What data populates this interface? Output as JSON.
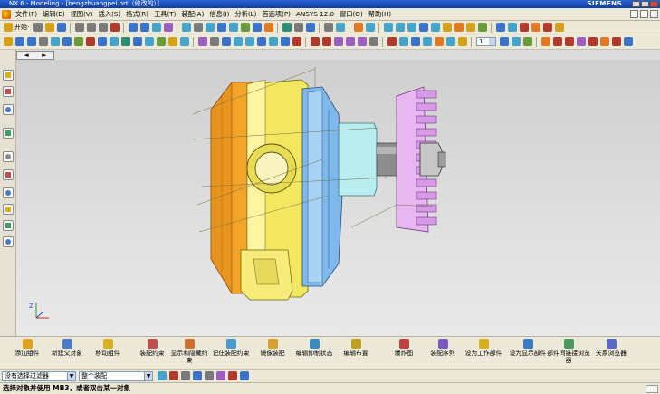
{
  "window": {
    "title": "NX 6 - Modeling - [bengzhuangpei.prt（修改的）]",
    "brand": "SIEMENS"
  },
  "menu": {
    "items": [
      "文件(F)",
      "编辑(E)",
      "视图(V)",
      "插入(S)",
      "格式(R)",
      "工具(T)",
      "装配(A)",
      "信息(I)",
      "分析(L)",
      "首选项(P)",
      "ANSYS 12.0",
      "窗口(O)",
      "帮助(H)"
    ]
  },
  "toolbar": {
    "start_label": "开始·",
    "layer_value": "1"
  },
  "nav": {
    "left_arrow": "◄",
    "right_arrow": "►"
  },
  "viewport": {
    "triad_label": "Z"
  },
  "assembly_toolbar": {
    "buttons": [
      {
        "label": "添加组件",
        "icon": "add-component-icon",
        "color": "#e0a020"
      },
      {
        "label": "新建父对象",
        "icon": "new-parent-icon",
        "color": "#4a7ac8"
      },
      {
        "label": "移动组件",
        "icon": "move-component-icon",
        "color": "#d8b020"
      },
      {
        "label": "装配约束",
        "icon": "assembly-constraint-icon",
        "color": "#c05050"
      },
      {
        "label": "显示和隐藏约束",
        "icon": "show-hide-constraint-icon",
        "color": "#d07030"
      },
      {
        "label": "记住装配约束",
        "icon": "remember-constraint-icon",
        "color": "#4a9ad0"
      },
      {
        "label": "镜像装配",
        "icon": "mirror-assembly-icon",
        "color": "#d8a030"
      },
      {
        "label": "编辑抑制状态",
        "icon": "edit-suppression-icon",
        "color": "#3a8ac0"
      },
      {
        "label": "编辑布置",
        "icon": "edit-arrangement-icon",
        "color": "#c0a020"
      },
      {
        "label": "爆炸图",
        "icon": "exploded-view-icon",
        "color": "#c04040"
      },
      {
        "label": "装配序列",
        "icon": "assembly-sequence-icon",
        "color": "#7a5ac0"
      },
      {
        "label": "设为工作部件",
        "icon": "set-work-part-icon",
        "color": "#d8b020"
      },
      {
        "label": "设为显示部件",
        "icon": "set-displayed-part-icon",
        "color": "#3a7ac8"
      },
      {
        "label": "部件间链接浏览器",
        "icon": "interpart-link-browser-icon",
        "color": "#4a9a60"
      },
      {
        "label": "关系浏览器",
        "icon": "relationship-browser-icon",
        "color": "#5a6ac8"
      }
    ]
  },
  "selection": {
    "filter_value": "没有选择过滤器",
    "scope_value": "整个装配"
  },
  "status": {
    "message": "选择对象并使用 MB3，或者双击某一对象"
  }
}
